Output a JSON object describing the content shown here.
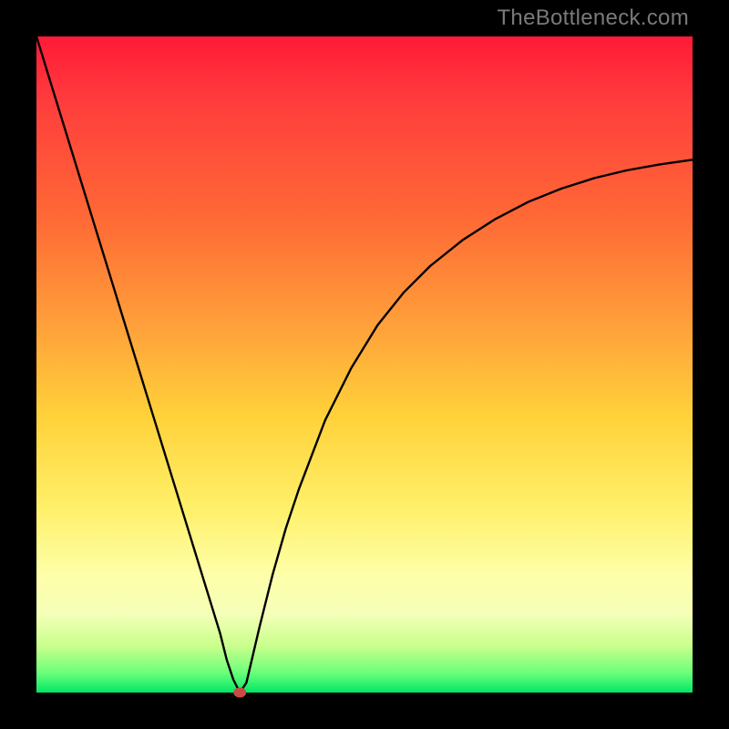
{
  "watermark": "TheBottleneck.com",
  "colors": {
    "frame": "#000000",
    "gradient_top": "#ff1a37",
    "gradient_mid1": "#ff6a35",
    "gradient_mid2": "#ffd23a",
    "gradient_mid3": "#feffa8",
    "gradient_bottom": "#00e765",
    "curve": "#000000",
    "marker": "#c94a45"
  },
  "chart_data": {
    "type": "line",
    "title": "",
    "xlabel": "",
    "ylabel": "",
    "xlim": [
      0,
      100
    ],
    "ylim": [
      0,
      100
    ],
    "x": [
      0,
      2,
      4,
      6,
      8,
      10,
      12,
      14,
      16,
      18,
      20,
      22,
      24,
      26,
      28,
      29,
      30,
      31,
      32,
      34,
      36,
      38,
      40,
      44,
      48,
      52,
      56,
      60,
      65,
      70,
      75,
      80,
      85,
      90,
      95,
      100
    ],
    "y": [
      100,
      93.5,
      87,
      80.5,
      74,
      67.5,
      61,
      54.5,
      48,
      41.5,
      35,
      28.5,
      22,
      15.5,
      9,
      5,
      2,
      0,
      1.5,
      10,
      18,
      25,
      31,
      41.5,
      49.5,
      56,
      61,
      65,
      69,
      72.2,
      74.8,
      76.8,
      78.4,
      79.6,
      80.5,
      81.2
    ],
    "marker": {
      "x": 31,
      "y": 0
    },
    "notes": "Values are approximate percentages read from the figure. x is horizontal position (0=left edge of plot, 100=right edge). y is vertical value (0=bottom/green, 100=top/red). The curve is a V-shape with minimum near x≈31, rising asymptotically on the right."
  }
}
